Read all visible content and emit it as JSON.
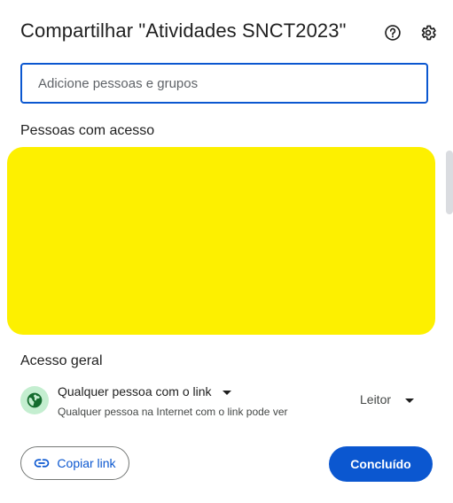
{
  "dialog": {
    "title": "Compartilhar \"Atividades SNCT2023\"",
    "help_icon": "help-circle-icon",
    "settings_icon": "gear-icon"
  },
  "search": {
    "placeholder": "Adicione pessoas e grupos",
    "value": ""
  },
  "people": {
    "label": "Pessoas com acesso",
    "redaction_color": "#fdf000"
  },
  "general_access": {
    "label": "Acesso geral",
    "icon": "globe-icon",
    "link_type": "Qualquer pessoa com o link",
    "description": "Qualquer pessoa na Internet com o link pode ver",
    "role": "Leitor"
  },
  "footer": {
    "copy_link_label": "Copiar link",
    "copy_link_icon": "link-icon",
    "done_label": "Concluído"
  },
  "colors": {
    "accent": "#0b57d0",
    "globe_bg": "#c4eed0"
  }
}
